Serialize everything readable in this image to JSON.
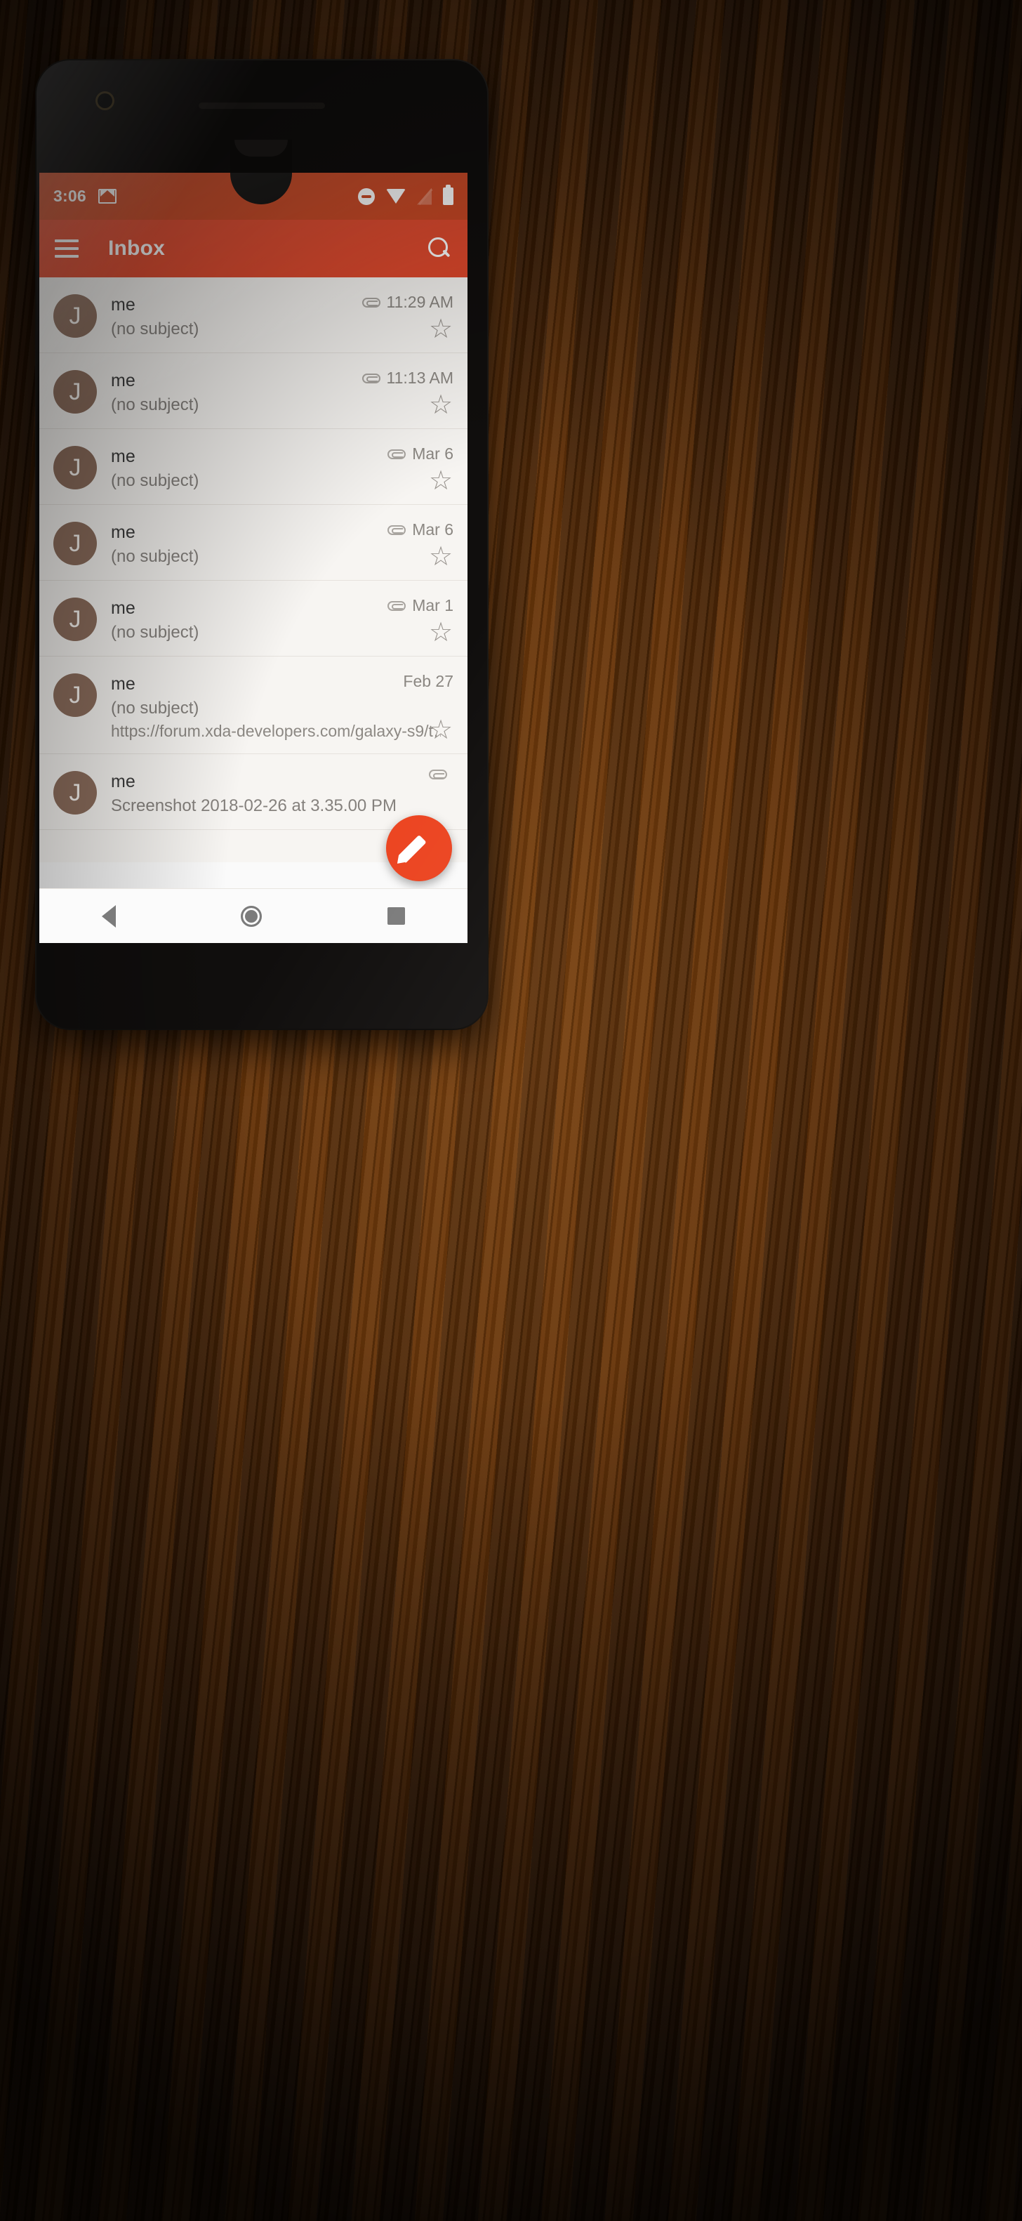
{
  "theme": {
    "status_bar_color": "#c9441f",
    "app_bar_color": "#e0472a",
    "fab_color": "#ec4420",
    "avatar_color": "#8d6e5d",
    "list_bg_color": "#f7f5f2",
    "desk_color": "#5d3009"
  },
  "status_bar": {
    "time": "3:06",
    "icons": {
      "gmail": "gmail-notification-icon",
      "dnd": "do-not-disturb-icon",
      "wifi": "wifi-icon",
      "signal": "no-signal-icon",
      "battery": "battery-full-icon"
    }
  },
  "app_bar": {
    "menu_icon": "hamburger-menu-icon",
    "title": "Inbox",
    "search_icon": "search-icon"
  },
  "mail_list": [
    {
      "avatar_letter": "J",
      "sender": "me",
      "subject": "(no subject)",
      "snippet": "",
      "date": "11:29 AM",
      "has_attachment": true,
      "starred": false
    },
    {
      "avatar_letter": "J",
      "sender": "me",
      "subject": "(no subject)",
      "snippet": "",
      "date": "11:13 AM",
      "has_attachment": true,
      "starred": false
    },
    {
      "avatar_letter": "J",
      "sender": "me",
      "subject": "(no subject)",
      "snippet": "",
      "date": "Mar 6",
      "has_attachment": true,
      "starred": false
    },
    {
      "avatar_letter": "J",
      "sender": "me",
      "subject": "(no subject)",
      "snippet": "",
      "date": "Mar 6",
      "has_attachment": true,
      "starred": false
    },
    {
      "avatar_letter": "J",
      "sender": "me",
      "subject": "(no subject)",
      "snippet": "",
      "date": "Mar 1",
      "has_attachment": true,
      "starred": false
    },
    {
      "avatar_letter": "J",
      "sender": "me",
      "subject": "(no subject)",
      "snippet": "https://forum.xda-developers.com/galaxy-s9/t…",
      "date": "Feb 27",
      "has_attachment": false,
      "starred": false
    },
    {
      "avatar_letter": "J",
      "sender": "me",
      "subject": "Screenshot 2018-02-26 at 3.35.00 PM",
      "snippet": "",
      "date": "",
      "has_attachment": true,
      "starred": false
    }
  ],
  "fab": {
    "icon": "compose-pencil-icon",
    "label": "Compose"
  },
  "nav_bar": {
    "back": "back-icon",
    "home": "home-icon",
    "recents": "recents-icon"
  },
  "star_glyph": "☆"
}
